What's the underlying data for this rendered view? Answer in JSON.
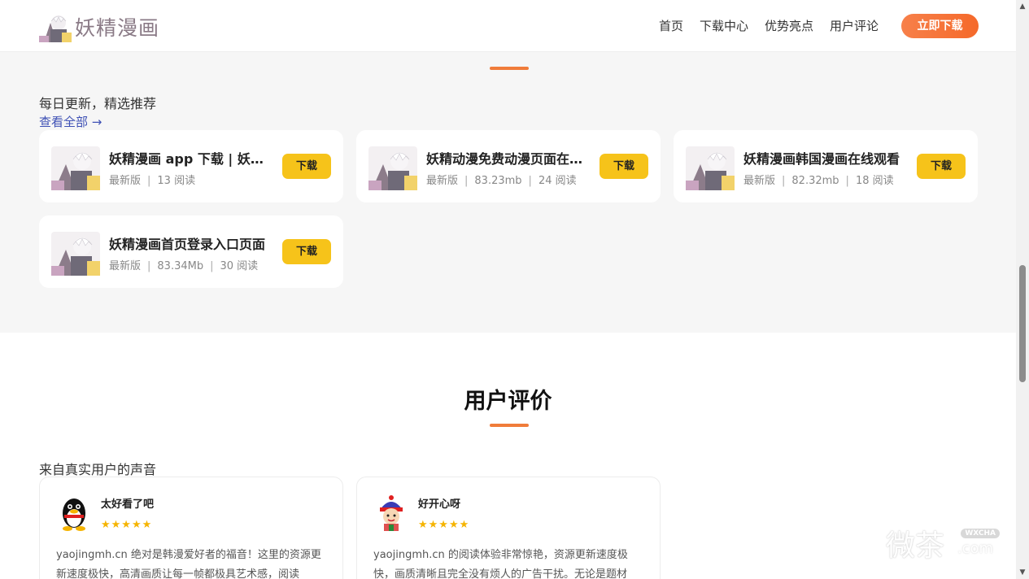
{
  "header": {
    "logo_text": "妖精漫画",
    "nav": [
      "首页",
      "下载中心",
      "优势亮点",
      "用户评论"
    ],
    "cta": "立即下载"
  },
  "downloads": {
    "subtitle": "每日更新，精选推荐",
    "view_all": "查看全部 →",
    "button_label": "下载",
    "items": [
      {
        "title": "妖精漫画 app 下载 | 妖精漫画",
        "version": "最新版",
        "size": "",
        "reads": "13 阅读"
      },
      {
        "title": "妖精动漫免费动漫页面在线看",
        "version": "最新版",
        "size": "83.23mb",
        "reads": "24 阅读"
      },
      {
        "title": "妖精漫画韩国漫画在线观看",
        "version": "最新版",
        "size": "82.32mb",
        "reads": "18 阅读"
      },
      {
        "title": "妖精漫画首页登录入口页面",
        "version": "最新版",
        "size": "83.34Mb",
        "reads": "30 阅读"
      }
    ]
  },
  "reviews": {
    "title": "用户评价",
    "subtitle": "来自真实用户的声音",
    "items": [
      {
        "name": "太好看了吧",
        "stars": "★★★★★",
        "text": "yaojingmh.cn 绝对是韩漫爱好者的福音！这里的资源更新速度极快，高清画质让每一帧都极具艺术感，阅读"
      },
      {
        "name": "好开心呀",
        "stars": "★★★★★",
        "text": "yaojingmh.cn 的阅读体验非常惊艳，资源更新速度极快，画质清晰且完全没有烦人的广告干扰。无论是题材"
      }
    ]
  },
  "watermark": {
    "text": "微茶",
    "badge": "WXCHA",
    "com": ".com"
  },
  "scrollbar": {
    "up": "▲",
    "down": "▼"
  }
}
